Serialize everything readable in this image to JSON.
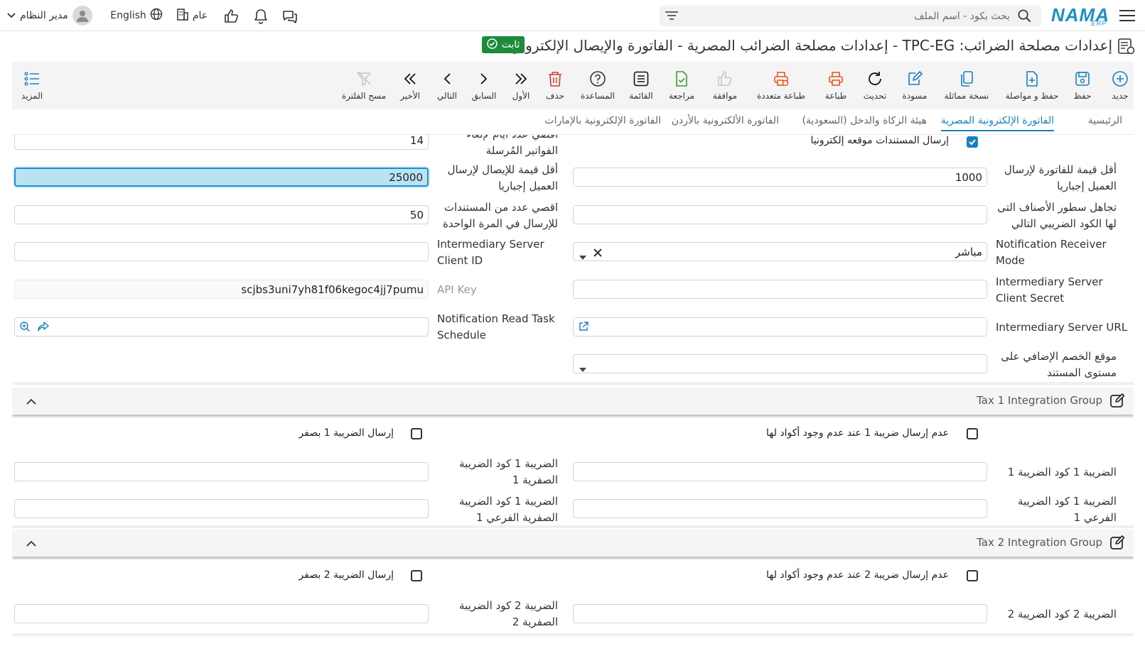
{
  "app": {
    "brand": "NAMA",
    "brand_sub": "ERP"
  },
  "topbar": {
    "search_placeholder": "بحث بكود - اسم الملف",
    "user_name": "مدير النظام",
    "language": "English",
    "company": "عام"
  },
  "page": {
    "title": "إعدادات مصلحة الضرائب: TPC-EG - إعدادات مصلحة الضرائب المصرية - الفاتورة والإيصال الإلكتروني",
    "status_badge": "ثابت"
  },
  "toolbar": {
    "new": "جديد",
    "save": "حفظ",
    "save_continue": "حفظ و مواصلة",
    "duplicate": "نسخة مماثلة",
    "draft": "مسودة",
    "refresh": "تحديث",
    "print": "طباعة",
    "multi_print": "طباعة متعددة",
    "approve": "موافقة",
    "review": "مراجعة",
    "list": "القائمة",
    "help": "المساعدة",
    "delete": "حذف",
    "first": "الأول",
    "previous": "السابق",
    "next": "التالي",
    "last": "الأخير",
    "clear_filter": "مسح الفلترة",
    "more": "المزيد"
  },
  "tabs": [
    {
      "label": "الرئيسية"
    },
    {
      "label": "الفاتورة الإلكترونية المصرية"
    },
    {
      "label": "هيئة الزكاة والدخل (السعودية)"
    },
    {
      "label": "الفاتورة الألكترونية بالأردن"
    },
    {
      "label": "الفاتورة الإلكترونية بالإمارات"
    }
  ],
  "form": {
    "send_signed_docs": {
      "label": "إرسال المستندات موقعه إلكترونيا",
      "checked": true
    },
    "max_days_cancel": {
      "label": "اقصي عدد ايام لإلغاء الفواتير المُرسلة",
      "value": "14"
    },
    "min_invoice_value": {
      "label": "أقل قيمة للفاتورة لإرسال العميل إجباريا",
      "value": "1000"
    },
    "min_receipt_value": {
      "label": "أقل قيمة للإيصال لإرسال العميل إجباريا",
      "value": "25000"
    },
    "ignore_item_lines": {
      "label": "تجاهل سطور الأصناف التى لها الكود الضريبي التالي",
      "value": ""
    },
    "max_docs_per_batch": {
      "label": "اقصي عدد من المستندات للإرسال في المرة الواحدة",
      "value": "50"
    },
    "notification_receiver_mode": {
      "label": "Notification Receiver Mode",
      "value": "مباشر"
    },
    "intermediary_client_id": {
      "label": "Intermediary Server Client ID",
      "value": ""
    },
    "intermediary_client_secret": {
      "label": "Intermediary Server Client Secret",
      "value": ""
    },
    "api_key": {
      "label": "API Key",
      "value": "scjbs3uni7yh81f06kegoc4jj7pumu"
    },
    "intermediary_url": {
      "label": "Intermediary Server URL",
      "value": ""
    },
    "notification_read_schedule": {
      "label": "Notification Read Task Schedule",
      "value": ""
    },
    "extra_discount_position": {
      "label": "موقع الخصم الإضافي على مستوى المستند",
      "value": ""
    }
  },
  "tax1": {
    "group_title": "Tax 1 Integration Group",
    "no_send_without_codes": {
      "label": "عدم إرسال ضريبة 1 عند عدم وجود أكواد لها",
      "checked": false
    },
    "send_zero": {
      "label": "إرسال الضريبة 1 بصفر",
      "checked": false
    },
    "tax_code": {
      "label": "الضريبة 1 كود الضريبة 1",
      "value": ""
    },
    "zero_tax_code": {
      "label": "الضريبة 1 كود الضريبة الصفرية 1",
      "value": ""
    },
    "sub_tax_code": {
      "label": "الضريبة 1 كود الضريبة الفرعي 1",
      "value": ""
    },
    "zero_sub_tax_code": {
      "label": "الضريبة 1 كود الضريبة الصفرية الفرعي 1",
      "value": ""
    }
  },
  "tax2": {
    "group_title": "Tax 2 Integration Group",
    "no_send_without_codes": {
      "label": "عدم إرسال ضريبة 2 عند عدم وجود أكواد لها",
      "checked": false
    },
    "send_zero": {
      "label": "إرسال الضريبة 2 بصفر",
      "checked": false
    },
    "tax_code": {
      "label": "الضريبة 2 كود الضريبة 2",
      "value": ""
    },
    "zero_tax_code": {
      "label": "الضريبة 2 كود الضريبة الصفرية 2",
      "value": ""
    }
  },
  "colors": {
    "accent": "#1a7fc1",
    "badge": "#1c8b3a",
    "orange": "#e8541b",
    "green": "#3a9a3a",
    "red": "#d23c2c"
  }
}
